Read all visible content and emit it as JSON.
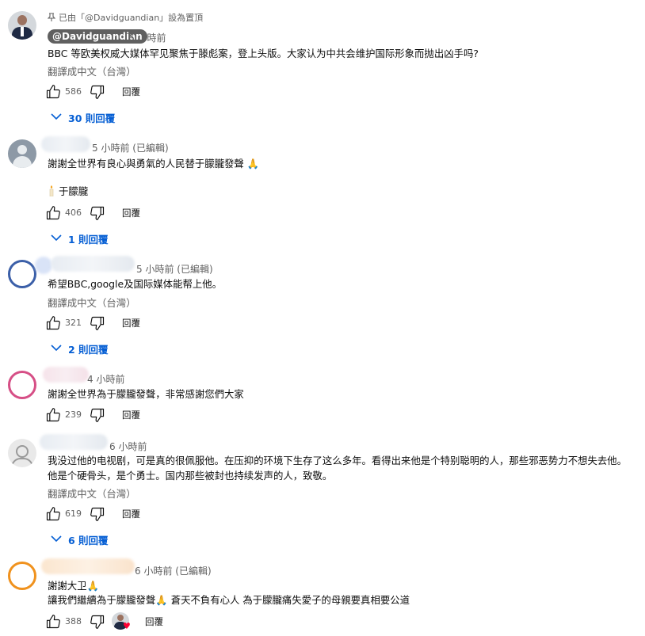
{
  "icons": {
    "pin": "pin-icon",
    "like": "thumbs-up-icon",
    "dislike": "thumbs-down-icon",
    "expand": "chevron-down-icon",
    "candle": "candle-icon",
    "pray": "folded-hands-emoji",
    "heart": "heart-icon"
  },
  "colors": {
    "link": "#065fd4",
    "meta": "#606060",
    "chip": "#606060",
    "heart": "#ff0033"
  },
  "comments": [
    {
      "pinned_label": "已由「@Davidguandian」設為置頂",
      "author": "@Davidguandian",
      "time": "6 小時前",
      "text": "BBC 等欧美权威大媒体罕见聚焦于滕彪案，登上头版。大家认为中共会维护国际形象而抛出凶手吗?",
      "translate": "翻譯成中文（台灣）",
      "likes": "586",
      "reply_label": "回覆",
      "replies_label": "30 則回覆"
    },
    {
      "time": "5 小時前 (已編輯)",
      "text": "謝謝全世界有良心與勇氣的人民替于朦朧發聲",
      "text2": "于朦朧",
      "likes": "406",
      "reply_label": "回覆",
      "replies_label": "1 則回覆"
    },
    {
      "time": "5 小時前 (已編輯)",
      "text": "希望BBC,google及国际媒体能帮上他。",
      "translate": "翻譯成中文（台灣）",
      "likes": "321",
      "reply_label": "回覆",
      "replies_label": "2 則回覆"
    },
    {
      "time": "4 小時前",
      "text": "謝謝全世界為于朦朧發聲，非常感謝您們大家",
      "likes": "239",
      "reply_label": "回覆"
    },
    {
      "time": "6 小時前",
      "text": "我没过他的电视剧，可是真的很佩服他。在压抑的环境下生存了这么多年。看得出来他是个特别聪明的人，那些邪恶势力不想失去他。",
      "text2": "他是个硬骨头，是个勇士。国内那些被封也持续发声的人，致敬。",
      "translate": "翻譯成中文（台灣）",
      "likes": "619",
      "reply_label": "回覆",
      "replies_label": "6 則回覆"
    },
    {
      "time": "6 小時前 (已編輯)",
      "text": "謝謝大卫",
      "text2": "讓我們繼續為于朦朧發聲",
      "text2b": "蒼天不負有心人  為于朦朧痛失愛子的母親要真相要公道",
      "likes": "388",
      "reply_label": "回覆"
    }
  ]
}
